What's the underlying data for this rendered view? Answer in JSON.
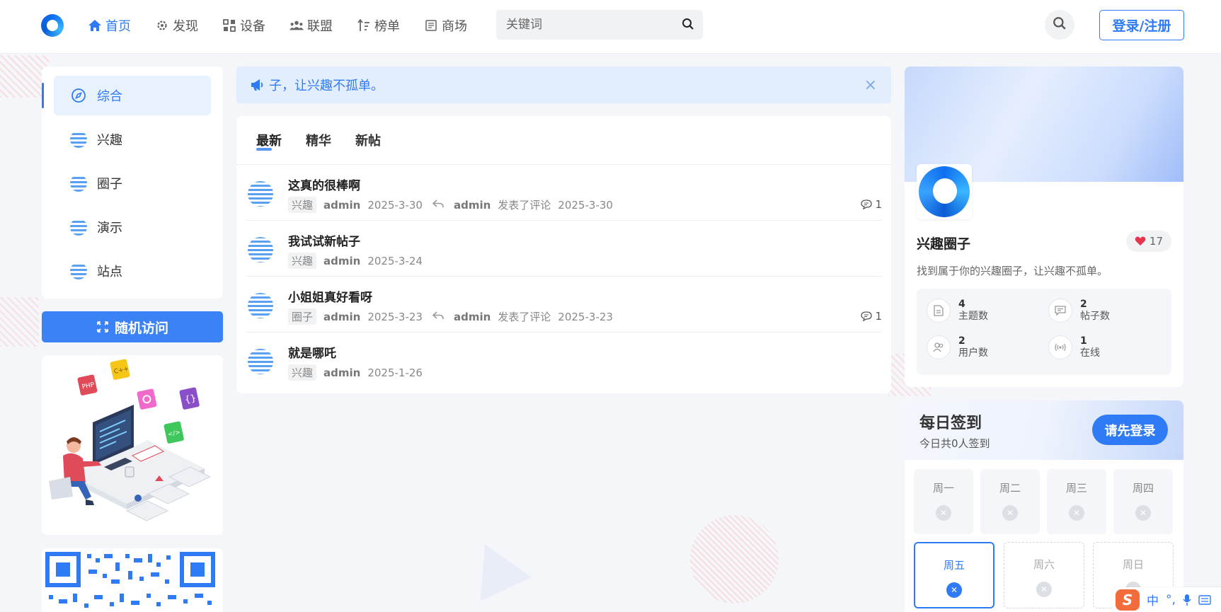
{
  "header": {
    "nav": [
      {
        "label": "首页",
        "icon": "home-icon",
        "active": true
      },
      {
        "label": "发现",
        "icon": "gear-icon",
        "active": false
      },
      {
        "label": "设备",
        "icon": "devices-icon",
        "active": false
      },
      {
        "label": "联盟",
        "icon": "users-icon",
        "active": false
      },
      {
        "label": "榜单",
        "icon": "ranking-icon",
        "active": false
      },
      {
        "label": "商场",
        "icon": "shop-icon",
        "active": false
      }
    ],
    "search_placeholder": "关键词",
    "login_label": "登录/注册"
  },
  "sidebar": {
    "items": [
      {
        "label": "综合",
        "icon": "compass-icon",
        "active": true
      },
      {
        "label": "兴趣",
        "icon": "circle-avatar-icon",
        "active": false
      },
      {
        "label": "圈子",
        "icon": "circle-avatar-icon",
        "active": false
      },
      {
        "label": "演示",
        "icon": "circle-avatar-icon",
        "active": false
      },
      {
        "label": "站点",
        "icon": "circle-avatar-icon",
        "active": false
      }
    ],
    "random_label": "随机访问"
  },
  "notice": {
    "text": "子，让兴趣不孤单。"
  },
  "feed": {
    "tabs": [
      {
        "label": "最新",
        "active": true
      },
      {
        "label": "精华",
        "active": false
      },
      {
        "label": "新帖",
        "active": false
      }
    ],
    "posts": [
      {
        "title": "这真的很棒啊",
        "tag": "兴趣",
        "author": "admin",
        "date": "2025-3-30",
        "reply_user": "admin",
        "reply_text": "发表了评论",
        "reply_date": "2025-3-30",
        "comments": "1"
      },
      {
        "title": "我试试新帖子",
        "tag": "兴趣",
        "author": "admin",
        "date": "2025-3-24",
        "reply_user": "",
        "reply_text": "",
        "reply_date": "",
        "comments": ""
      },
      {
        "title": "小姐姐真好看呀",
        "tag": "圈子",
        "author": "admin",
        "date": "2025-3-23",
        "reply_user": "admin",
        "reply_text": "发表了评论",
        "reply_date": "2025-3-23",
        "comments": "1"
      },
      {
        "title": "就是哪吒",
        "tag": "兴趣",
        "author": "admin",
        "date": "2025-1-26",
        "reply_user": "",
        "reply_text": "",
        "reply_date": "",
        "comments": ""
      }
    ]
  },
  "profile": {
    "name": "兴趣圈子",
    "likes": "17",
    "description": "找到属于你的兴趣圈子，让兴趣不孤单。",
    "stats": [
      {
        "num": "4",
        "label": "主题数",
        "icon": "document-icon"
      },
      {
        "num": "2",
        "label": "帖子数",
        "icon": "message-icon"
      },
      {
        "num": "2",
        "label": "用户数",
        "icon": "users-icon"
      },
      {
        "num": "1",
        "label": "在线",
        "icon": "broadcast-icon"
      }
    ]
  },
  "checkin": {
    "title": "每日签到",
    "subtitle": "今日共0人签到",
    "button": "请先登录",
    "days": [
      {
        "label": "周一",
        "state": "past"
      },
      {
        "label": "周二",
        "state": "past"
      },
      {
        "label": "周三",
        "state": "past"
      },
      {
        "label": "周四",
        "state": "past"
      },
      {
        "label": "周五",
        "state": "today"
      },
      {
        "label": "周六",
        "state": "future"
      },
      {
        "label": "周日",
        "state": "future"
      }
    ]
  },
  "ime": {
    "mode": "中",
    "punct": "°,",
    "logo": "S"
  },
  "colors": {
    "accent": "#2f7bf5",
    "background": "#f4f6fa",
    "heart": "#e5344b"
  }
}
